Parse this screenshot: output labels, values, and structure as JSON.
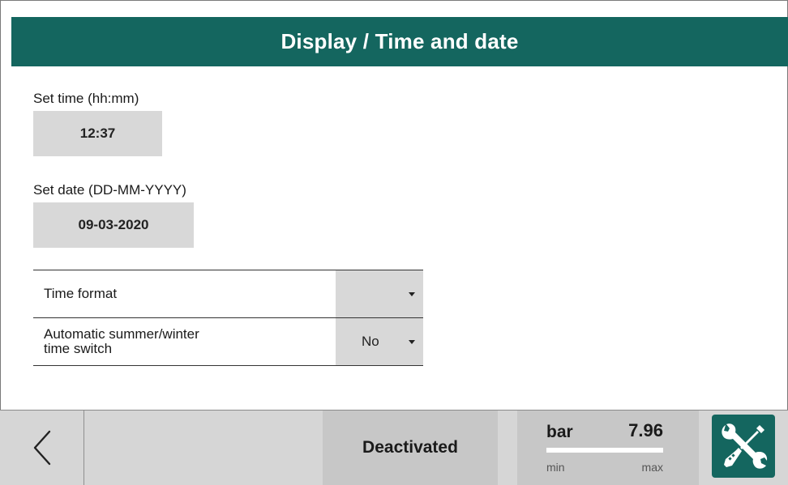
{
  "header": {
    "title": "Display / Time and date"
  },
  "time": {
    "label": "Set time (hh:mm)",
    "value": "12:37"
  },
  "date": {
    "label": "Set date (DD-MM-YYYY)",
    "value": "09-03-2020"
  },
  "settings": [
    {
      "label": "Time format",
      "value": ""
    },
    {
      "label_line1": "Automatic summer/winter",
      "label_line2": "time switch",
      "value": "No"
    }
  ],
  "footer": {
    "status": "Deactivated",
    "gauge": {
      "unit": "bar",
      "value": "7.96",
      "min_label": "min",
      "max_label": "max",
      "level": 1.0
    }
  },
  "colors": {
    "accent": "#14665f",
    "panel": "#d8d8d8",
    "footer": "#d6d6d6"
  },
  "icons": {
    "back": "chevron-left-icon",
    "tools": "wrench-screwdriver-icon",
    "dropdown": "caret-down-icon"
  }
}
